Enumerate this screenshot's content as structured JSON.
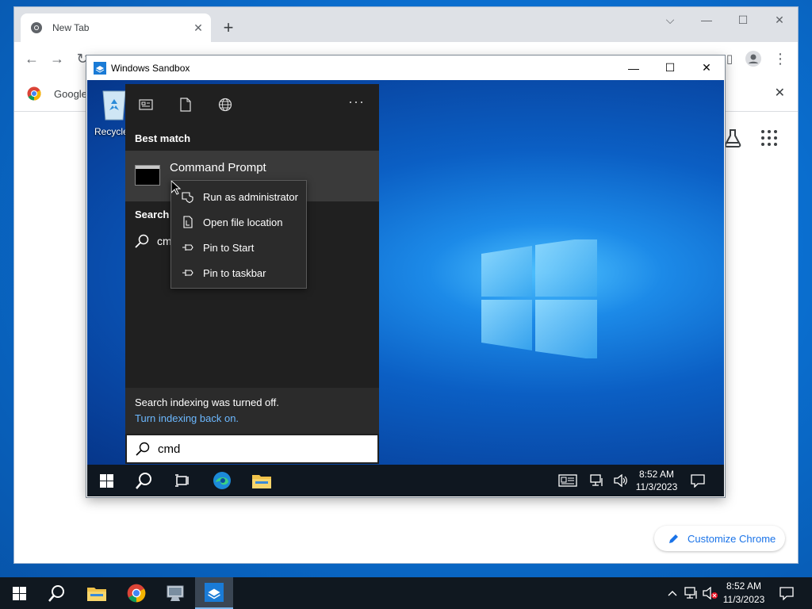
{
  "browser": {
    "tab_title": "New Tab",
    "bookmark_label": "Google",
    "customize_label": "Customize Chrome"
  },
  "sandbox": {
    "title": "Windows Sandbox",
    "recycle_label": "Recycle"
  },
  "search_menu": {
    "best_match_heading": "Best match",
    "result_title": "Command Prompt",
    "search_web_heading": "Search t",
    "web_query": "cm",
    "indexing_message": "Search indexing was turned off.",
    "indexing_link": "Turn indexing back on.",
    "search_value": "cmd",
    "more_label": "···"
  },
  "context_menu": {
    "items": [
      {
        "label": "Run as administrator",
        "icon": "shield-icon"
      },
      {
        "label": "Open file location",
        "icon": "file-location-icon"
      },
      {
        "label": "Pin to Start",
        "icon": "pin-icon"
      },
      {
        "label": "Pin to taskbar",
        "icon": "pin-icon"
      }
    ]
  },
  "sandbox_taskbar": {
    "time": "8:52 AM",
    "date": "11/3/2023"
  },
  "host_taskbar": {
    "time": "8:52 AM",
    "date": "11/3/2023"
  },
  "colors": {
    "accent": "#1a73e8",
    "link": "#6cb8ff",
    "menu_bg": "#202020"
  }
}
